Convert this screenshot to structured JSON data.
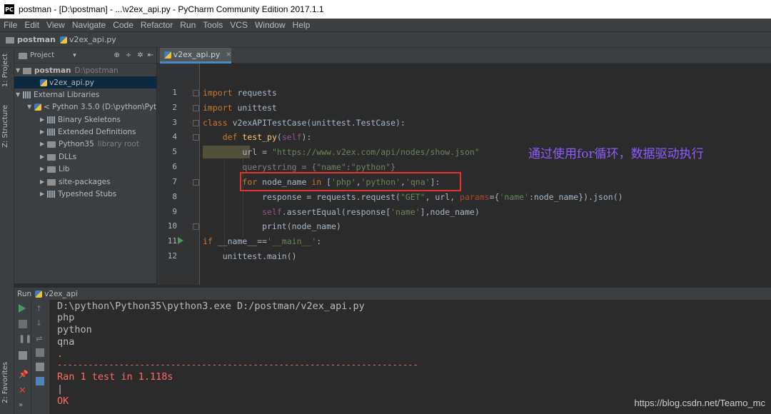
{
  "window": {
    "title": "postman - [D:\\postman] - ...\\v2ex_api.py - PyCharm Community Edition 2017.1.1",
    "app_icon": "PC"
  },
  "menu": [
    "File",
    "Edit",
    "View",
    "Navigate",
    "Code",
    "Refactor",
    "Run",
    "Tools",
    "VCS",
    "Window",
    "Help"
  ],
  "breadcrumb": {
    "project": "postman",
    "file": "v2ex_api.py"
  },
  "leftstrip": {
    "project_tab": "1: Project",
    "structure_tab": "Z: Structure",
    "favorites_tab": "2: Favorites"
  },
  "project_panel": {
    "header": "Project",
    "root": {
      "name": "postman",
      "path": "D:\\postman"
    },
    "file": "v2ex_api.py",
    "external": "External Libraries",
    "python": "< Python 3.5.0 (D:\\python\\Pyth",
    "items": [
      "Binary Skeletons",
      "Extended Definitions",
      "Python35",
      "DLLs",
      "Lib",
      "site-packages",
      "Typeshed Stubs"
    ],
    "python35_note": "library root"
  },
  "editor": {
    "tab": "v2ex_api.py",
    "line_numbers": [
      "1",
      "2",
      "3",
      "4",
      "5",
      "6",
      "7",
      "8",
      "9",
      "10",
      "11",
      "12"
    ],
    "annotation": "通过使用for循环，数据驱动执行"
  },
  "run": {
    "title": "Run",
    "config": "v2ex_api",
    "console": [
      "D:\\python\\Python35\\python3.exe D:/postman/v2ex_api.py",
      "php",
      "python",
      "qna",
      ".",
      "----------------------------------------------------------------------",
      "Ran 1 test in 1.118s",
      "|",
      "OK"
    ]
  },
  "watermark": "https://blog.csdn.net/Teamo_mc"
}
